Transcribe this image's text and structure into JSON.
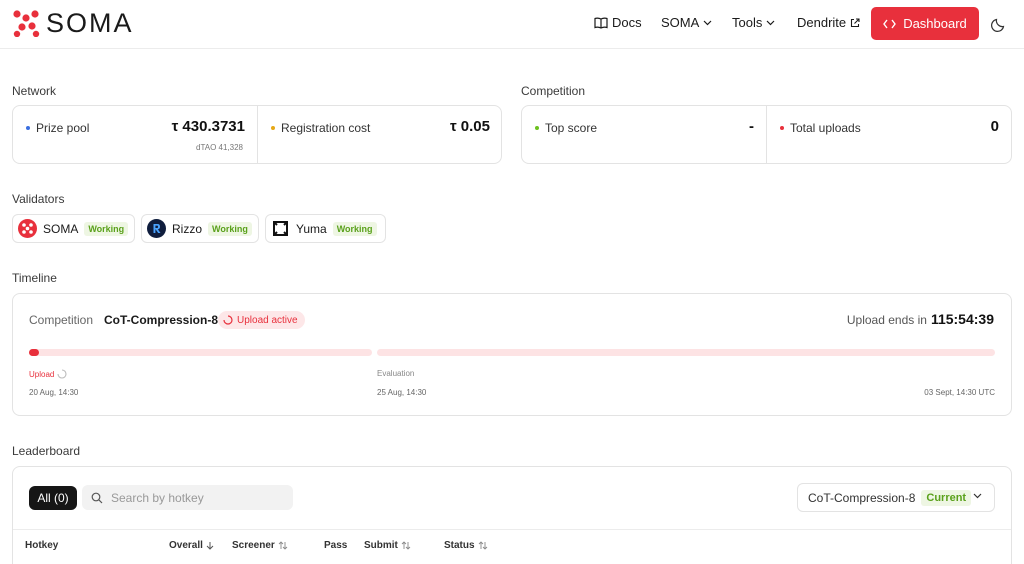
{
  "header": {
    "logo_text": "SOMA",
    "nav": {
      "docs": "Docs",
      "soma": "SOMA",
      "tools": "Tools",
      "dendrite": "Dendrite"
    },
    "dashboard_label": "Dashboard"
  },
  "network": {
    "label": "Network",
    "prize_pool": {
      "label": "Prize pool",
      "value": "τ 430.3731",
      "sub": "dTAO 41,328"
    },
    "registration_cost": {
      "label": "Registration cost",
      "value": "τ 0.05"
    }
  },
  "competition": {
    "label": "Competition",
    "top_score": {
      "label": "Top score",
      "value": "-"
    },
    "total_uploads": {
      "label": "Total uploads",
      "value": "0"
    }
  },
  "validators": {
    "label": "Validators",
    "items": [
      {
        "name": "SOMA",
        "status": "Working"
      },
      {
        "name": "Rizzo",
        "status": "Working"
      },
      {
        "name": "Yuma",
        "status": "Working"
      }
    ]
  },
  "timeline": {
    "label": "Timeline",
    "competition_label": "Competition",
    "competition_name": "CoT-Compression-8",
    "status_badge": "Upload active",
    "ends_label": "Upload ends in",
    "ends_value": "115:54:39",
    "upload_progress": 0.03,
    "phases": {
      "upload": {
        "label": "Upload",
        "date": "20 Aug, 14:30"
      },
      "evaluation": {
        "label": "Evaluation",
        "date": "25 Aug, 14:30"
      },
      "end_date": "03 Sept, 14:30 UTC"
    }
  },
  "leaderboard": {
    "label": "Leaderboard",
    "all_label": "All (0)",
    "search_placeholder": "Search by hotkey",
    "competition_select": "CoT-Compression-8",
    "current_badge": "Current",
    "columns": {
      "hotkey": "Hotkey",
      "overall": "Overall",
      "screener": "Screener",
      "pass": "Pass",
      "submit": "Submit",
      "status": "Status"
    }
  },
  "colors": {
    "accent": "#e8303c",
    "working": "#5aa11b",
    "blue_dot": "#3b6fe0",
    "yellow_dot": "#e6a817",
    "green_dot": "#6cc11f"
  }
}
